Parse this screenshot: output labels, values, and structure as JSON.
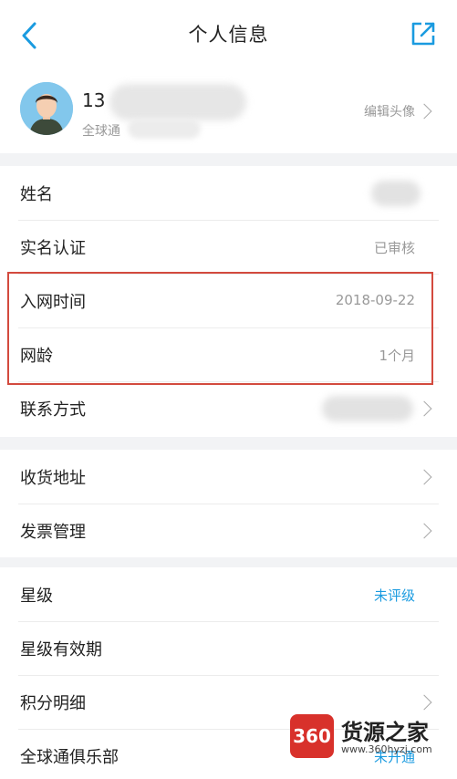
{
  "header": {
    "title": "个人信息",
    "back_icon": "chevron-left-icon",
    "share_icon": "share-out-icon"
  },
  "profile": {
    "phone_prefix": "13",
    "subtitle": "全球通",
    "edit_avatar_label": "编辑头像"
  },
  "group1": [
    {
      "label": "姓名",
      "value": ""
    },
    {
      "label": "实名认证",
      "value": "已审核"
    },
    {
      "label": "入网时间",
      "value": "2018-09-22"
    },
    {
      "label": "网龄",
      "value": "1个月"
    },
    {
      "label": "联系方式",
      "value": ""
    }
  ],
  "group2": [
    {
      "label": "收货地址"
    },
    {
      "label": "发票管理"
    }
  ],
  "group3": [
    {
      "label": "星级",
      "value": "未评级"
    },
    {
      "label": "星级有效期",
      "value": ""
    },
    {
      "label": "积分明细",
      "value": ""
    },
    {
      "label": "全球通俱乐部",
      "value": "未开通"
    }
  ],
  "colors": {
    "accent": "#1a9be0",
    "highlight_border": "#d34a3e"
  },
  "watermark": {
    "logo_text": "360",
    "name": "货源之家",
    "url": "www.360hyzj.com"
  }
}
